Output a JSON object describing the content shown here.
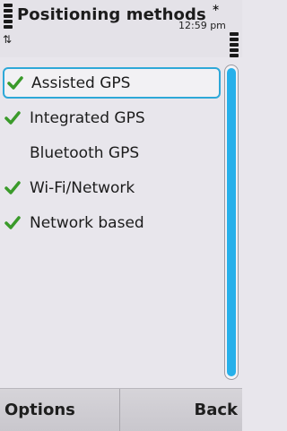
{
  "status": {
    "title": "Positioning methods",
    "time": "12:59 pm",
    "bluetooth_glyph": "∗",
    "connection_glyph": "⇅"
  },
  "list": {
    "items": [
      {
        "label": "Assisted GPS",
        "checked": true,
        "highlighted": true
      },
      {
        "label": "Integrated GPS",
        "checked": true
      },
      {
        "label": "Bluetooth GPS",
        "checked": false
      },
      {
        "label": "Wi-Fi/Network",
        "checked": true
      },
      {
        "label": "Network based",
        "checked": true
      }
    ]
  },
  "softkeys": {
    "left": "Options",
    "right": "Back"
  },
  "colors": {
    "accent": "#2ea8d8",
    "check": "#3a9a2a",
    "background": "#e8e6ec"
  }
}
